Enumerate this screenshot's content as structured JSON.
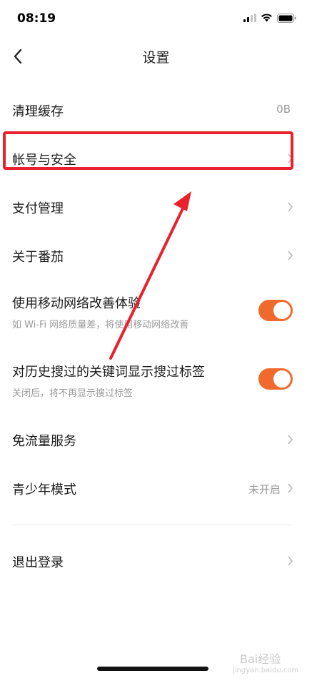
{
  "status_bar": {
    "time": "08:19"
  },
  "nav": {
    "title": "设置"
  },
  "settings": [
    {
      "label": "清理缓存",
      "value": "0B"
    },
    {
      "label": "帐号与安全"
    },
    {
      "label": "支付管理"
    },
    {
      "label": "关于番茄"
    },
    {
      "label": "使用移动网络改善体验",
      "sub": "如 Wi-Fi 网络质量差，将使用移动网络改善",
      "toggle_on": true
    },
    {
      "label": "对历史搜过的关键词显示搜过标签",
      "sub": "关闭后，将不再显示搜过标签",
      "toggle_on": true
    },
    {
      "label": "免流量服务"
    },
    {
      "label": "青少年模式",
      "value": "未开启"
    },
    {
      "label": "退出登录"
    }
  ],
  "colors": {
    "accent": "#f06a2e",
    "annotation_red": "#e8212c"
  },
  "watermark": {
    "text": "Bai经验",
    "url_text": "jingyan.baidu.com"
  }
}
